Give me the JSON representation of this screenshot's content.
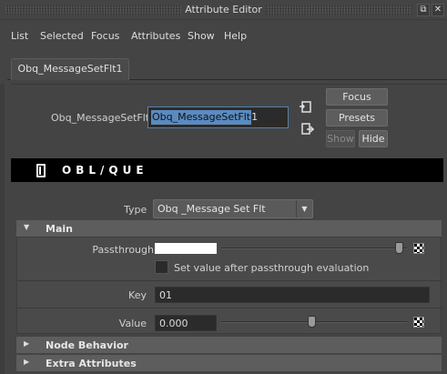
{
  "window": {
    "title": "Attribute Editor",
    "float_glyph": "⧉",
    "close_glyph": "✕"
  },
  "menu": [
    "List",
    "Selected",
    "Focus",
    "Attributes",
    "Show",
    "Help"
  ],
  "tabs": [
    {
      "label": "Obq_MessageSetFlt1"
    }
  ],
  "node": {
    "label": "Obq_MessageSetFlt:",
    "value_selected": "Obq_MessageSetFlt",
    "value_rest": "1",
    "buttons": {
      "focus": "Focus",
      "presets": "Presets",
      "show": "Show",
      "hide": "Hide"
    }
  },
  "banner": {
    "logo_text": "OBL/QUE"
  },
  "type": {
    "label": "Type",
    "value": "Obq _Message Set Flt"
  },
  "sections": {
    "main": "Main",
    "node_behavior": "Node Behavior",
    "extra_attributes": "Extra Attributes"
  },
  "main": {
    "passthrough": {
      "label": "Passthrough",
      "color": "#ffffff",
      "slider_fraction": 1.0
    },
    "checkbox": {
      "label": "Set value after passthrough evaluation",
      "checked": false
    },
    "key": {
      "label": "Key",
      "value": "01"
    },
    "value": {
      "label": "Value",
      "value": "0.000",
      "slider_fraction": 0.5
    }
  },
  "colors": {
    "panel_bg": "#444444",
    "section_header": "#5d5d5d",
    "field_bg": "#2b2b2b",
    "selection": "#5a8bc0",
    "banner_bg": "#000000"
  }
}
